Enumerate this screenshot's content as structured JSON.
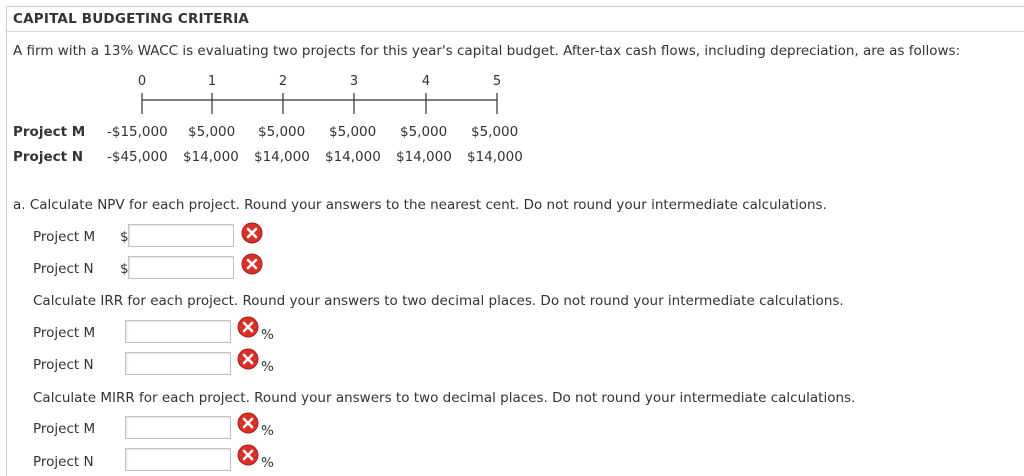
{
  "page": {
    "title": "CAPITAL BUDGETING CRITERIA",
    "intro": "A firm with a 13% WACC is evaluating two projects for this year's capital budget. After-tax cash flows, including depreciation, are as follows:"
  },
  "timeline": {
    "periods": [
      "0",
      "1",
      "2",
      "3",
      "4",
      "5"
    ]
  },
  "cash_flows": {
    "project_m": {
      "label": "Project M",
      "values": [
        "-$15,000",
        "$5,000",
        "$5,000",
        "$5,000",
        "$5,000",
        "$5,000"
      ]
    },
    "project_n": {
      "label": "Project N",
      "values": [
        "-$45,000",
        "$14,000",
        "$14,000",
        "$14,000",
        "$14,000",
        "$14,000"
      ]
    }
  },
  "questions": {
    "npv": {
      "prompt": "a. Calculate NPV for each project. Round your answers to the nearest cent. Do not round your intermediate calculations.",
      "project_m_label": "Project M",
      "project_n_label": "Project N",
      "currency": "$",
      "project_m_value": "",
      "project_n_value": ""
    },
    "irr": {
      "prompt": "Calculate IRR for each project. Round your answers to two decimal places. Do not round your intermediate calculations.",
      "project_m_label": "Project M",
      "project_n_label": "Project N",
      "unit": "%",
      "project_m_value": "",
      "project_n_value": ""
    },
    "mirr": {
      "prompt": "Calculate MIRR for each project. Round your answers to two decimal places. Do not round your intermediate calculations.",
      "project_m_label": "Project M",
      "project_n_label": "Project N",
      "unit": "%",
      "project_m_value": "",
      "project_n_value": ""
    }
  },
  "icons": {
    "incorrect": "x-circle-icon"
  },
  "colors": {
    "incorrect_red": "#d9302a",
    "border": "#c2c2c2"
  }
}
